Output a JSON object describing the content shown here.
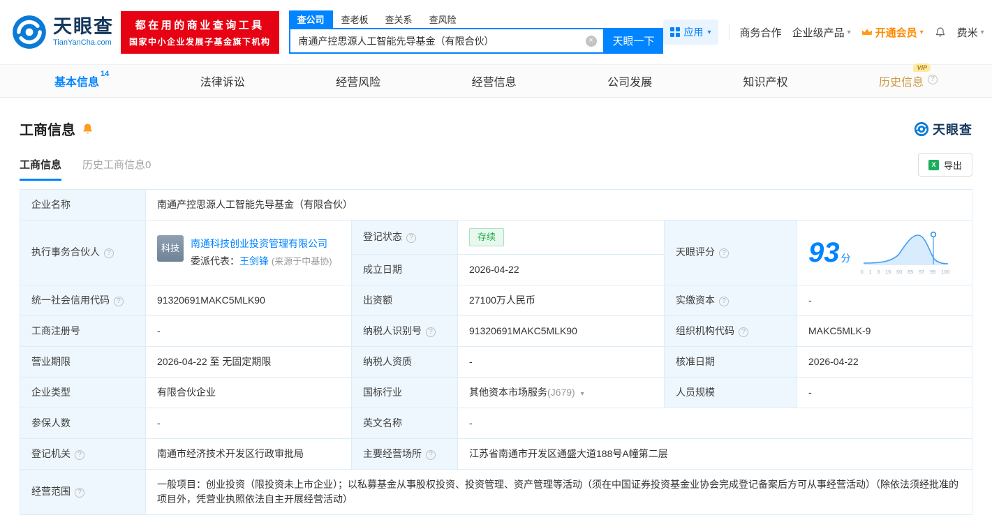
{
  "icons": {
    "caret_down": "▾",
    "clear": "×",
    "help": "?",
    "excel": "X"
  },
  "header": {
    "logo": {
      "brand": "天眼查",
      "domain": "TianYanCha.com"
    },
    "slogan": {
      "line1": "都在用的商业查询工具",
      "line2": "国家中小企业发展子基金旗下机构"
    },
    "search": {
      "tabs": [
        {
          "label": "查公司"
        },
        {
          "label": "查老板"
        },
        {
          "label": "查关系"
        },
        {
          "label": "查风险"
        }
      ],
      "value": "南通产控思源人工智能先导基金（有限合伙）",
      "button": "天眼一下"
    },
    "menu": {
      "app": "应用",
      "cooperation": "商务合作",
      "enterprise": "企业级产品",
      "vip": "开通会员",
      "user": "费米"
    }
  },
  "nav": {
    "vip_badge": "VIP",
    "tabs": [
      {
        "label": "基本信息",
        "count": "14"
      },
      {
        "label": "法律诉讼"
      },
      {
        "label": "经营风险"
      },
      {
        "label": "经营信息"
      },
      {
        "label": "公司发展"
      },
      {
        "label": "知识产权"
      },
      {
        "label": "历史信息"
      }
    ]
  },
  "section": {
    "title": "工商信息",
    "brand": "天眼查",
    "subtabs": [
      {
        "label": "工商信息"
      },
      {
        "label": "历史工商信息0"
      }
    ],
    "export_label": "导出"
  },
  "table": {
    "company_name": {
      "label": "企业名称",
      "value": "南通产控思源人工智能先导基金（有限合伙）"
    },
    "partner": {
      "label": "执行事务合伙人",
      "logo_text": "科技",
      "company": "南通科技创业投资管理有限公司",
      "rep_label": "委派代表：",
      "rep_name": "王剑锋",
      "rep_source": "(来源于中基协)"
    },
    "reg_status": {
      "label": "登记状态",
      "value": "存续"
    },
    "establish_date": {
      "label": "成立日期",
      "value": "2026-04-22"
    },
    "score": {
      "label": "天眼评分",
      "value": "93",
      "unit": "分",
      "axis": [
        "0",
        "1",
        "3",
        "15",
        "50",
        "85",
        "97",
        "99",
        "100"
      ]
    },
    "credit_code": {
      "label": "统一社会信用代码",
      "value": "91320691MAKC5MLK90"
    },
    "capital": {
      "label": "出资额",
      "value": "27100万人民币"
    },
    "paid_capital": {
      "label": "实缴资本",
      "value": "-"
    },
    "reg_number": {
      "label": "工商注册号",
      "value": "-"
    },
    "taxpayer_id": {
      "label": "纳税人识别号",
      "value": "91320691MAKC5MLK90"
    },
    "org_code": {
      "label": "组织机构代码",
      "value": "MAKC5MLK-9"
    },
    "business_term": {
      "label": "营业期限",
      "value": "2026-04-22 至 无固定期限"
    },
    "taxpayer_quality": {
      "label": "纳税人资质",
      "value": "-"
    },
    "approval_date": {
      "label": "核准日期",
      "value": "2026-04-22"
    },
    "company_type": {
      "label": "企业类型",
      "value": "有限合伙企业"
    },
    "industry": {
      "label": "国标行业",
      "value": "其他资本市场服务",
      "code": "(J679)"
    },
    "staff_size": {
      "label": "人员规模",
      "value": "-"
    },
    "insured_count": {
      "label": "参保人数",
      "value": "-"
    },
    "english_name": {
      "label": "英文名称",
      "value": "-"
    },
    "reg_authority": {
      "label": "登记机关",
      "value": "南通市经济技术开发区行政审批局"
    },
    "business_place": {
      "label": "主要经营场所",
      "value": "江苏省南通市开发区通盛大道188号A幢第二层"
    },
    "business_scope": {
      "label": "经营范围",
      "value": "一般项目：创业投资（限投资未上市企业）；以私募基金从事股权投资、投资管理、资产管理等活动（须在中国证券投资基金业协会完成登记备案后方可从事经营活动）（除依法须经批准的项目外，凭营业执照依法自主开展经营活动）"
    }
  }
}
